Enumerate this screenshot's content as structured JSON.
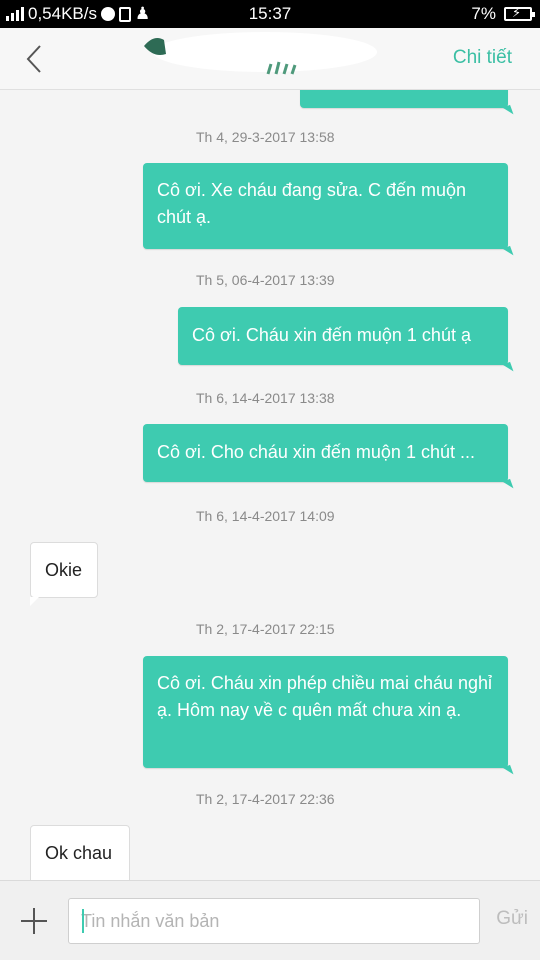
{
  "status_bar": {
    "network_speed": "0,54KB/s",
    "time": "15:37",
    "battery": "7%"
  },
  "header": {
    "details_label": "Chi tiết"
  },
  "messages": [
    {
      "timestamp": "Th 4, 29-3-2017  13:58",
      "direction": "out",
      "text": "Cô ơi.  Xe cháu đang sửa.  C đến muộn chút ạ."
    },
    {
      "timestamp": "Th 5, 06-4-2017  13:39",
      "direction": "out",
      "text": "Cô ơi.  Cháu xin đến muộn 1 chút ạ"
    },
    {
      "timestamp": "Th 6, 14-4-2017  13:38",
      "direction": "out",
      "text": "Cô ơi. Cho cháu xin đến muộn 1 chút ..."
    },
    {
      "timestamp": "Th 6, 14-4-2017  14:09",
      "direction": "in",
      "text": "Okie"
    },
    {
      "timestamp": "Th 2, 17-4-2017  22:15",
      "direction": "out",
      "text": "Cô ơi.  Cháu xin phép chiều mai cháu nghỉ ạ.  Hôm nay về c quên mất chưa xin ạ."
    },
    {
      "timestamp": "Th 2, 17-4-2017  22:36",
      "direction": "in",
      "text": "Ok chau"
    }
  ],
  "composer": {
    "placeholder": "Tin nhắn văn bản",
    "value": "",
    "send_label": "Gửi"
  },
  "colors": {
    "accent": "#3ecbb0",
    "link": "#3bbfa4"
  }
}
